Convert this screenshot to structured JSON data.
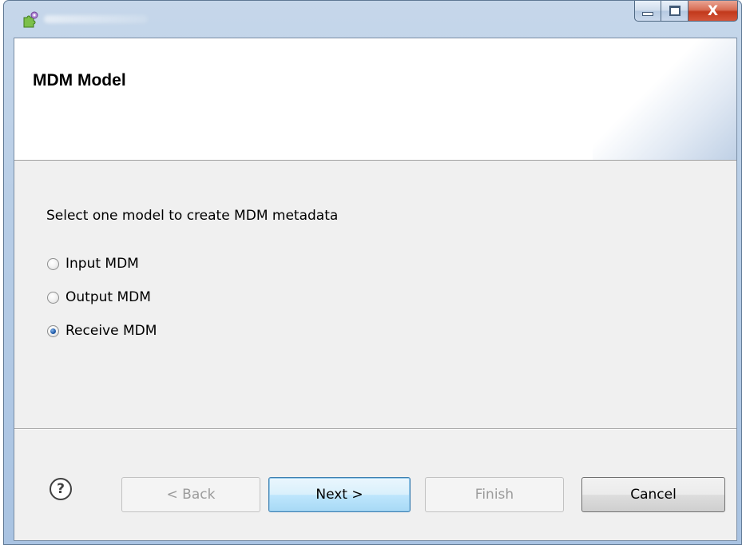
{
  "window": {
    "app_icon": "puzzle-gear-icon",
    "caption_buttons": {
      "close_glyph": "X"
    }
  },
  "wizard": {
    "title": "MDM Model",
    "instruction": "Select one model to create MDM metadata",
    "options": [
      {
        "label": "Input MDM",
        "selected": false
      },
      {
        "label": "Output MDM",
        "selected": false
      },
      {
        "label": "Receive MDM",
        "selected": true
      }
    ]
  },
  "footer": {
    "help_glyph": "?",
    "back_label": "< Back",
    "next_label": "Next >",
    "finish_label": "Finish",
    "cancel_label": "Cancel"
  },
  "colors": {
    "default_button_border": "#3c7fb1",
    "close_button": "#c2391c",
    "radio_dot": "#1f5aa8"
  }
}
